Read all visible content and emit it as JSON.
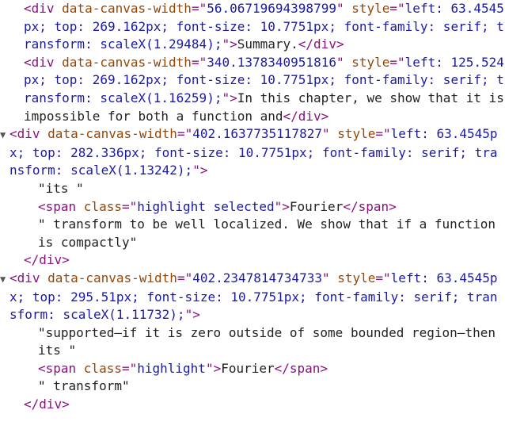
{
  "colors": {
    "tag": "#881280",
    "attr_name": "#994500",
    "attr_value": "#1a1aa6",
    "text": "#222222",
    "triangle": "#555555"
  },
  "nodes": [
    {
      "type": "leaf",
      "tag": "div",
      "attrs": [
        {
          "name": "data-canvas-width",
          "value": "56.06719694398799"
        },
        {
          "name": "style",
          "value": "left: 63.4545px; top: 269.162px; font-size: 10.7751px; font-family: serif; transform: scaleX(1.29484);"
        }
      ],
      "text": "Summary."
    },
    {
      "type": "leaf",
      "tag": "div",
      "attrs": [
        {
          "name": "data-canvas-width",
          "value": "340.1378340951816"
        },
        {
          "name": "style",
          "value": "left: 125.524px; top: 269.162px; font-size: 10.7751px; font-family: serif; transform: scaleX(1.16259);"
        }
      ],
      "text": "In this chapter, we show that it is impossible for both a function and"
    },
    {
      "type": "expanded",
      "tag": "div",
      "attrs": [
        {
          "name": "data-canvas-width",
          "value": "402.1637735117827"
        },
        {
          "name": "style",
          "value": "left: 63.4545px; top: 282.336px; font-size: 10.7751px; font-family: serif; transform: scaleX(1.13242);"
        }
      ],
      "children": [
        {
          "kind": "text",
          "text": "\"its \""
        },
        {
          "kind": "span",
          "class": "highlight selected",
          "text": "Fourier"
        },
        {
          "kind": "text",
          "text": "\" transform to be well localized. We show that if a function is compactly\""
        }
      ]
    },
    {
      "type": "expanded",
      "tag": "div",
      "attrs": [
        {
          "name": "data-canvas-width",
          "value": "402.2347814734733"
        },
        {
          "name": "style",
          "value": "left: 63.4545px; top: 295.51px; font-size: 10.7751px; font-family: serif; transform: scaleX(1.11732);"
        }
      ],
      "children": [
        {
          "kind": "text",
          "text": "\"supported—if it is zero outside of some bounded region—then its \""
        },
        {
          "kind": "span",
          "class": "highlight",
          "text": "Fourier"
        },
        {
          "kind": "text",
          "text": "\" transform\""
        }
      ]
    }
  ]
}
